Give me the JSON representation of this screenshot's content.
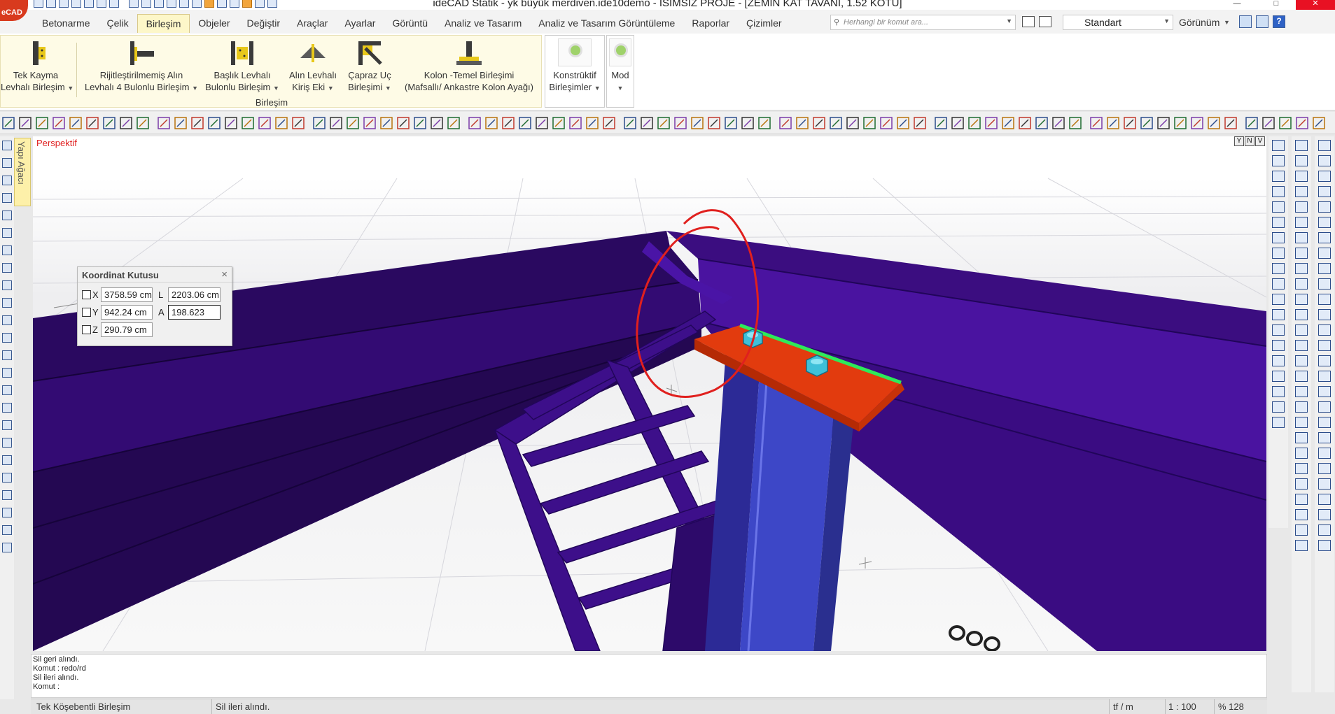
{
  "window": {
    "title": "ideCAD Statik - yk büyük merdiven.ide10demo - İSİMSİZ PROJE - [ZEMİN KAT TAVANI,  1.52 KOTU]",
    "logo_text": "eCAD",
    "controls": {
      "minimize": "—",
      "maximize": "□",
      "close": "✕"
    }
  },
  "ribbon_tabs": [
    {
      "label": "Betonarme"
    },
    {
      "label": "Çelik"
    },
    {
      "label": "Birleşim"
    },
    {
      "label": "Objeler"
    },
    {
      "label": "Değiştir"
    },
    {
      "label": "Araçlar"
    },
    {
      "label": "Ayarlar"
    },
    {
      "label": "Görüntü"
    },
    {
      "label": "Analiz ve Tasarım"
    },
    {
      "label": "Analiz ve Tasarım Görüntüleme"
    },
    {
      "label": "Raporlar"
    },
    {
      "label": "Çizimler"
    }
  ],
  "search": {
    "placeholder": "Herhangi bir komut ara..."
  },
  "style_select": {
    "value": "Standart"
  },
  "view_menu": {
    "label": "Görünüm"
  },
  "ribbon": {
    "group_label": "Birleşim",
    "buttons": [
      {
        "line1": "Tek Kayma",
        "line2": "Levhalı Birleşim"
      },
      {
        "line1": "Rijitleştirilmemiş Alın",
        "line2": "Levhalı 4 Bulonlu Birleşim"
      },
      {
        "line1": "Başlık Levhalı",
        "line2": "Bulonlu Birleşim"
      },
      {
        "line1": "Alın Levhalı",
        "line2": "Kiriş Eki"
      },
      {
        "line1": "Çapraz Uç",
        "line2": "Birleşimi"
      },
      {
        "line1": "Kolon -Temel Birleşimi",
        "line2": "(Mafsallı/ Ankastre Kolon Ayağı)"
      }
    ],
    "konstruktif": {
      "line1": "Konstrüktif",
      "line2": "Birleşimler"
    },
    "mod": {
      "label": "Mod"
    }
  },
  "side_tab": {
    "label": "Yapı Ağacı"
  },
  "viewport": {
    "view_mode": "Perspektif",
    "view_controls": [
      "Y",
      "N",
      "V"
    ]
  },
  "coord_box": {
    "title": "Koordinat Kutusu",
    "x_label": "X",
    "x_value": "3758.59 cm",
    "y_label": "Y",
    "y_value": "942.24 cm",
    "z_label": "Z",
    "z_value": "290.79 cm",
    "l_label": "L",
    "l_value": "2203.06 cm",
    "a_label": "A",
    "a_value": "198.623"
  },
  "command_history": [
    "Sil geri alındı.",
    "Komut : redo/rd",
    "Sil ileri alındı.",
    "Komut :"
  ],
  "status_bar": {
    "selected_object": "Tek Köşebentli Birleşim",
    "message": "Sil ileri alındı.",
    "unit": "tf / m",
    "scale": "1 : 100",
    "zoom": "% 128"
  },
  "colors": {
    "beam_purple": "#3c0e78",
    "column_blue": "#3d47c7",
    "plate_orange": "#e23b0e",
    "bolt_cyan": "#3fc0d9",
    "weld_green": "#2eea5a",
    "annotation_red": "#e0201e",
    "active_tab": "#fdf7c9"
  }
}
